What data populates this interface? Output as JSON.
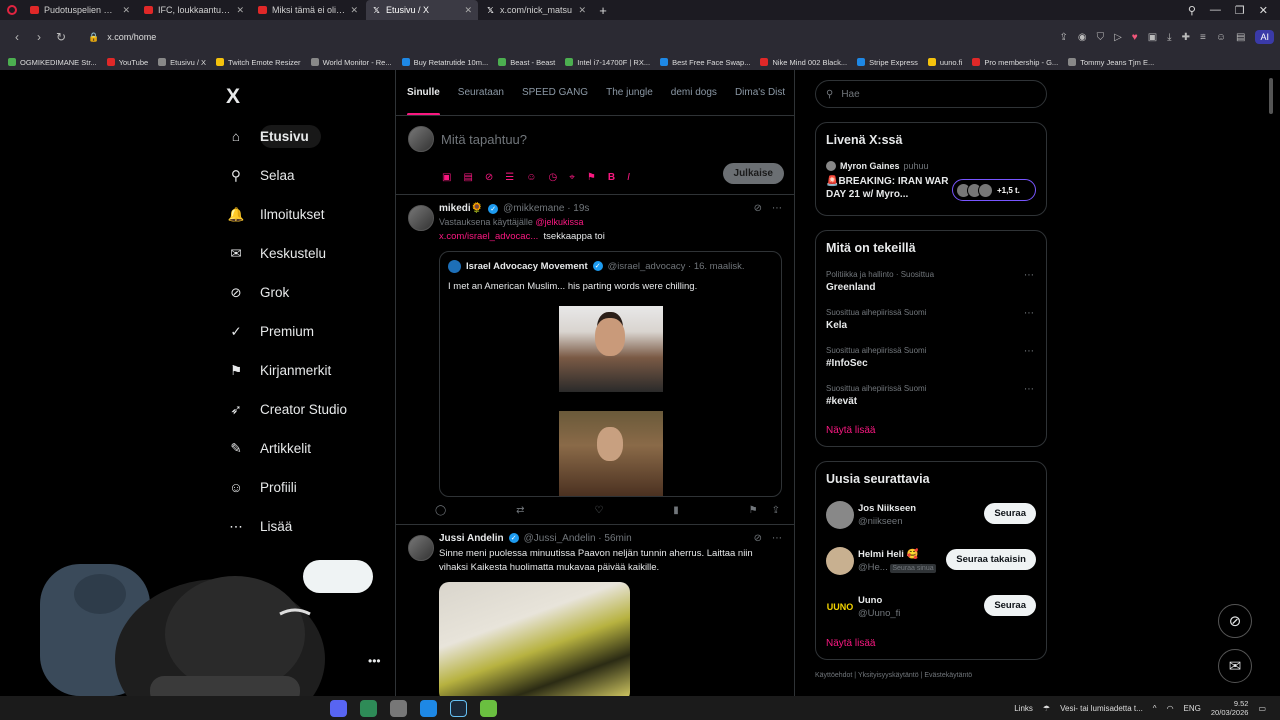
{
  "tabs": [
    {
      "title": "Pudotuspelien ekan kierr",
      "icon": "youtube-icon"
    },
    {
      "title": "IFC, loukkaantuminen & V",
      "icon": "youtube-icon"
    },
    {
      "title": "Miksi tämä ei olisi Patrik L",
      "icon": "youtube-icon"
    },
    {
      "title": "Etusivu / X",
      "icon": "x-icon",
      "active": true
    },
    {
      "title": "x.com/nick_matsu",
      "icon": "x-icon"
    }
  ],
  "address": {
    "url": "x.com/home",
    "ai_label": "AI"
  },
  "bookmarks": [
    "OGMIKEDIMANE Str...",
    "YouTube",
    "Etusivu / X",
    "Twitch Emote Resizer",
    "World Monitor - Re...",
    "Buy Retatrutide 10m...",
    "Beast - Beast",
    "Intel i7-14700F | RX...",
    "Best Free Face Swap...",
    "Nike Mind 002 Black...",
    "Stripe Express",
    "uuno.fi",
    "Pro membership - G...",
    "Tommy Jeans Tjm E..."
  ],
  "sidebar": {
    "logo": "X",
    "items": [
      {
        "label": "Etusivu",
        "icon": "home-icon",
        "glyph": "⌂"
      },
      {
        "label": "Selaa",
        "icon": "search-icon",
        "glyph": "⚲"
      },
      {
        "label": "Ilmoitukset",
        "icon": "bell-icon",
        "glyph": "🔔"
      },
      {
        "label": "Keskustelu",
        "icon": "mail-icon",
        "glyph": "✉"
      },
      {
        "label": "Grok",
        "icon": "grok-icon",
        "glyph": "⊘"
      },
      {
        "label": "Premium",
        "icon": "verified-icon",
        "glyph": "✓"
      },
      {
        "label": "Kirjanmerkit",
        "icon": "bookmark-icon",
        "glyph": "⚑"
      },
      {
        "label": "Creator Studio",
        "icon": "rocket-icon",
        "glyph": "➶"
      },
      {
        "label": "Artikkelit",
        "icon": "article-icon",
        "glyph": "✎"
      },
      {
        "label": "Profiili",
        "icon": "person-icon",
        "glyph": "☺"
      },
      {
        "label": "Lisää",
        "icon": "more-icon",
        "glyph": "⋯"
      }
    ]
  },
  "feed_tabs": [
    "Sinulle",
    "Seurataan",
    "SPEED GANG",
    "The jungle",
    "demi dogs",
    "Dima's Dist"
  ],
  "composer": {
    "placeholder": "Mitä tapahtuu?",
    "publish": "Julkaise"
  },
  "posts": [
    {
      "name": "mikedi🌻",
      "handle": "@mikkemane · 19s",
      "reply_prefix": "Vastauksena käyttäjälle",
      "reply_to": "@jelkukissa",
      "link": "x.com/israel_advocac...",
      "text": "tsekkaappa toi",
      "quote": {
        "name": "Israel Advocacy Movement",
        "handle": "@israel_advocacy · 16. maalisk.",
        "text": "I met an American Muslim... his parting words were chilling."
      }
    },
    {
      "name": "Jussi Andelin",
      "handle": "@Jussi_Andelin · 56min",
      "text": "Sinne meni puolessa minuutissa Paavon neljän tunnin aherrus. Laittaa niin vihaksi     Kaikesta huolimatta mukavaa päivää kaikille."
    }
  ],
  "search": {
    "placeholder": "Hae"
  },
  "live": {
    "title": "Livenä X:ssä",
    "host": "Myron Gaines",
    "host_suffix": "puhuu",
    "headline": "🚨BREAKING: IRAN WAR DAY 21 w/ Myro...",
    "count": "+1,5 t."
  },
  "trends": {
    "title": "Mitä on tekeillä",
    "items": [
      {
        "category": "Politiikka ja hallinto · Suosittua",
        "topic": "Greenland"
      },
      {
        "category": "Suosittua aihepiirissä Suomi",
        "topic": "Kela"
      },
      {
        "category": "Suosittua aihepiirissä Suomi",
        "topic": "#InfoSec"
      },
      {
        "category": "Suosittua aihepiirissä Suomi",
        "topic": "#kevät"
      }
    ],
    "show_more": "Näytä lisää"
  },
  "who_to_follow": {
    "title": "Uusia seurattavia",
    "items": [
      {
        "name": "Jos Niikseen",
        "handle": "@niikseen",
        "button": "Seuraa"
      },
      {
        "name": "Helmi Heli 🥰",
        "handle": "@He...",
        "badge": "Seuraa sinua",
        "button": "Seuraa takaisin"
      },
      {
        "name": "Uuno",
        "handle": "@Uuno_fi",
        "button": "Seuraa"
      }
    ],
    "show_more": "Näytä lisää"
  },
  "footer": "Käyttöehdot  |  Yksityisyyskäytäntö  |  Evästekäytäntö",
  "taskbar": {
    "links": "Links",
    "weather": "Vesi- tai lumisadetta t...",
    "lang": "ENG",
    "time": "9.52",
    "date": "20/03/2026"
  }
}
